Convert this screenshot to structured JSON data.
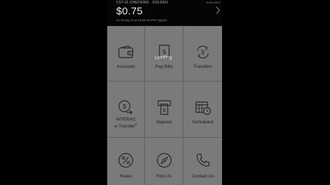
{
  "account": {
    "name": "CST-01 CHECKING - GOLDEN",
    "badge": "AVAILABLE",
    "balance": "$0.75",
    "as_of": "As 10 Aug 21 at 10:04 AM PST Approx"
  },
  "overlay": {
    "status": "Loading"
  },
  "tiles": [
    {
      "label": "Accounts",
      "icon": "wallet-icon"
    },
    {
      "label": "Pay Bills",
      "icon": "bill-icon"
    },
    {
      "label": "Transfers",
      "icon": "transfer-icon"
    },
    {
      "label_line1": "INTERAC",
      "label_line2": "e-Transfer",
      "label_mark": "®",
      "icon": "interac-icon"
    },
    {
      "label": "Deposit",
      "icon": "deposit-icon"
    },
    {
      "label": "Scheduled",
      "icon": "calendar-icon"
    },
    {
      "label": "Rates",
      "icon": "percent-icon"
    },
    {
      "label": "Find Us",
      "icon": "compass-icon"
    },
    {
      "label": "Contact Us",
      "icon": "phone-icon"
    }
  ],
  "colors": {
    "tile_bg": "#7a7a7a",
    "grid_line": "#5f5f5f",
    "header_bg": "#050505",
    "icon_stroke": "#262626"
  }
}
